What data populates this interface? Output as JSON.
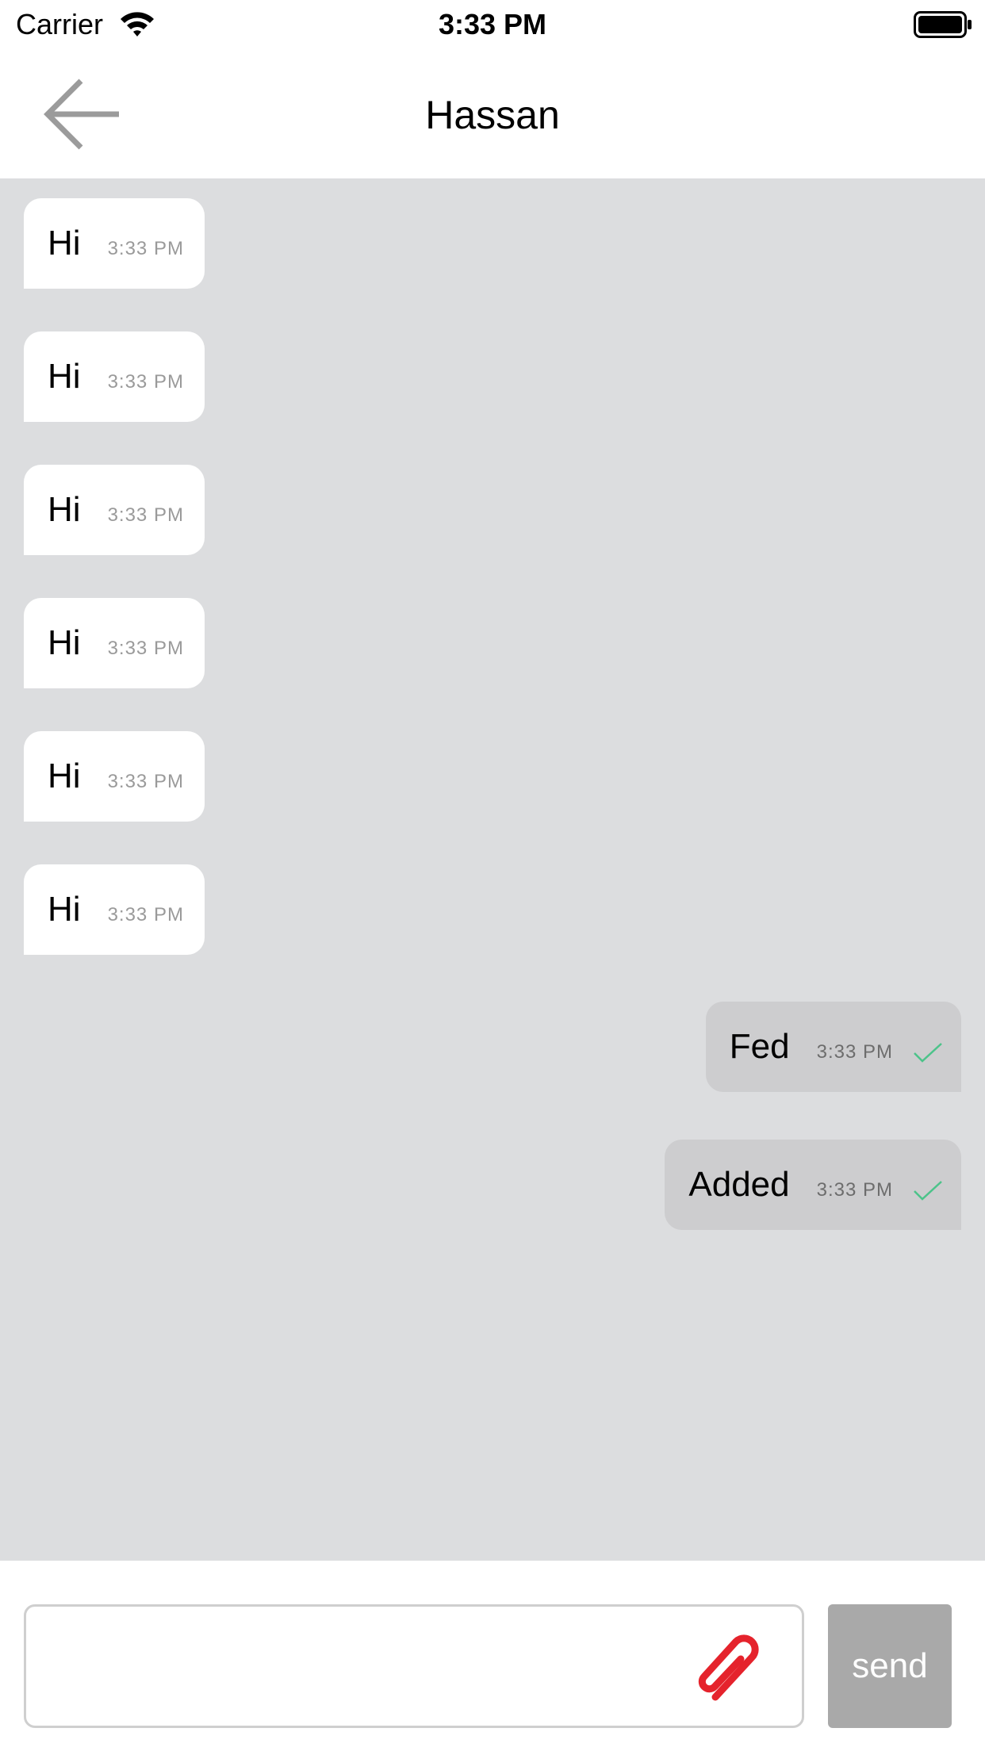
{
  "status_bar": {
    "carrier": "Carrier",
    "time": "3:33 PM",
    "wifi_icon": "wifi-icon",
    "battery_icon": "battery-icon"
  },
  "header": {
    "title": "Hassan",
    "back_icon": "arrow-left-icon"
  },
  "messages": [
    {
      "direction": "incoming",
      "text": "Hi",
      "time": "3:33 PM"
    },
    {
      "direction": "incoming",
      "text": "Hi",
      "time": "3:33 PM"
    },
    {
      "direction": "incoming",
      "text": "Hi",
      "time": "3:33 PM"
    },
    {
      "direction": "incoming",
      "text": "Hi",
      "time": "3:33 PM"
    },
    {
      "direction": "incoming",
      "text": "Hi",
      "time": "3:33 PM"
    },
    {
      "direction": "incoming",
      "text": "Hi",
      "time": "3:33 PM"
    },
    {
      "direction": "outgoing",
      "text": "Fed",
      "time": "3:33 PM",
      "status_icon": "check-icon"
    },
    {
      "direction": "outgoing",
      "text": "Added",
      "time": "3:33 PM",
      "status_icon": "check-icon"
    }
  ],
  "composer": {
    "input_value": "",
    "input_placeholder": "",
    "attach_icon": "paperclip-icon",
    "send_label": "send"
  },
  "colors": {
    "chat_background": "#dcdddf",
    "incoming_bubble": "#ffffff",
    "outgoing_bubble": "#cdcdcf",
    "check_mark": "#4cc38a",
    "paperclip": "#e5232c",
    "send_button": "#a9a9a9"
  }
}
